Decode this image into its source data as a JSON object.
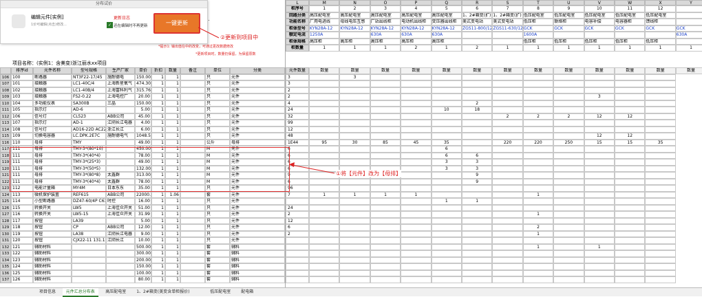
{
  "popup": {
    "title": "分布试价",
    "product_name": "编辑元件[实例]",
    "product_desc": "1价可编辑(点击)修改...",
    "link_label": "更新日志",
    "checkbox_label": "还在编辑时不再更新",
    "update_button": "一键更新"
  },
  "annotations": {
    "step2": "②更新到项目中",
    "step1": "①将【元件】改为【母排】",
    "note1": "*提示1: 输出值在中的改变，可通过更改数据修改",
    "note2": "*更新项目时，数量仍保留，为保留原数"
  },
  "left_header_suffix": "CD.",
  "project_name": "项目名称：(实例1：含美变)浙江丽水xx项目",
  "left_columns": [
    "排序id",
    "元件名称",
    "型号规格",
    "生产厂家",
    "单价",
    "折扣",
    "数量",
    "备注",
    "单位",
    "分类"
  ],
  "left_rows": [
    {
      "no": "106",
      "id": "100",
      "name": "断路器",
      "model": "NT3F22-17/45",
      "maker": "施耐德电",
      "price": "150.00",
      "d": "1",
      "q": "1",
      "unit": "只",
      "cat": "元件"
    },
    {
      "no": "107",
      "id": "101",
      "name": "接触器",
      "model": "LC1-40C/4",
      "maker": "上海新星氧气",
      "price": "474.30",
      "d": "1",
      "q": "1",
      "unit": "只",
      "cat": "元件"
    },
    {
      "no": "108",
      "id": "102",
      "name": "接触器",
      "model": "LC1-40B/4",
      "maker": "上海富科利气",
      "price": "315.76",
      "d": "1",
      "q": "1",
      "unit": "只",
      "cat": "元件"
    },
    {
      "no": "109",
      "id": "103",
      "name": "接触器",
      "model": "FS2-0.22",
      "maker": "上海电控厂",
      "price": "20.00",
      "d": "1",
      "q": "1",
      "unit": "只",
      "cat": "元件"
    },
    {
      "no": "110",
      "id": "104",
      "name": "多功能仪表",
      "model": "SA300B",
      "maker": "三晶",
      "price": "150.00",
      "d": "1",
      "q": "1",
      "unit": "只",
      "cat": "元件"
    },
    {
      "no": "111",
      "id": "105",
      "name": "指示灯",
      "model": "AD-6",
      "maker": "",
      "price": "5.00",
      "d": "1",
      "q": "1",
      "unit": "只",
      "cat": "元件"
    },
    {
      "no": "112",
      "id": "106",
      "name": "信号灯",
      "model": "CL523",
      "maker": "ABB公司",
      "price": "45.00",
      "d": "1",
      "q": "1",
      "unit": "只",
      "cat": "元件"
    },
    {
      "no": "113",
      "id": "107",
      "name": "指示灯",
      "model": "AD-1",
      "maker": "江阴长江电器",
      "price": "4.00",
      "d": "1",
      "q": "1",
      "unit": "只",
      "cat": "元件"
    },
    {
      "no": "114",
      "id": "108",
      "name": "信号灯",
      "model": "AD16-22D AC220V",
      "maker": "浙江长江",
      "price": "6.00",
      "d": "1",
      "q": "1",
      "unit": "只",
      "cat": "元件"
    },
    {
      "no": "115",
      "id": "109",
      "name": "切换电容器",
      "model": "LC.DPK.2E7C",
      "maker": "施耐德电气",
      "price": "1048.52",
      "d": "1",
      "q": "1",
      "unit": "只",
      "cat": "元件"
    },
    {
      "no": "116",
      "id": "110",
      "name": "母排",
      "model": "TMY",
      "maker": "",
      "price": "49.00",
      "d": "1",
      "q": "1",
      "unit": "公斤",
      "cat": "母排"
    },
    {
      "no": "117",
      "id": "111",
      "name": "母排",
      "model": "TMY-3*(80*10)",
      "maker": "",
      "price": "450.00",
      "d": "1",
      "q": "1",
      "unit": "M",
      "cat": "元件"
    },
    {
      "no": "118",
      "id": "111",
      "name": "母排",
      "model": "TMY-3*(40*4)",
      "maker": "",
      "price": "78.00",
      "d": "1",
      "q": "1",
      "unit": "M",
      "cat": "元件"
    },
    {
      "no": "119",
      "id": "111",
      "name": "母排",
      "model": "TMY-3*(25*3)",
      "maker": "",
      "price": "49.00",
      "d": "1",
      "q": "1",
      "unit": "M",
      "cat": "元件"
    },
    {
      "no": "120",
      "id": "111",
      "name": "母排",
      "model": "TMY-3*(50*5)",
      "maker": "",
      "price": "132.00",
      "d": "1",
      "q": "1",
      "unit": "M",
      "cat": "元件"
    },
    {
      "no": "121",
      "id": "111",
      "name": "母排",
      "model": "TMY-3*(80*8)",
      "maker": "太鑫群",
      "price": "313.00",
      "d": "1",
      "q": "1",
      "unit": "M",
      "cat": "元件"
    },
    {
      "no": "122",
      "id": "111",
      "name": "母排",
      "model": "TMY-3*(40*4)",
      "maker": "太鑫群",
      "price": "78.00",
      "d": "1",
      "q": "1",
      "unit": "M",
      "cat": "元件"
    },
    {
      "no": "123",
      "id": "112",
      "name": "电能计量箱",
      "model": "MY4M",
      "maker": "日本东东",
      "price": "35.00",
      "d": "1",
      "q": "1",
      "unit": "只",
      "cat": "元件"
    },
    {
      "no": "124",
      "id": "113",
      "name": "微机保护装置",
      "model": "REF615",
      "maker": "ABB公司",
      "price": "22000.00",
      "d": "1",
      "q": "1.06",
      "unit": "套",
      "cat": "元件"
    },
    {
      "no": "125",
      "id": "114",
      "name": "小型断路器",
      "model": "DZ47-60/4P C63A",
      "maker": "时控",
      "price": "16.00",
      "d": "1",
      "q": "1",
      "unit": "只",
      "cat": "元件"
    },
    {
      "no": "126",
      "id": "115",
      "name": "转换开关",
      "model": "LW5",
      "maker": "上海佳众开关",
      "price": "51.00",
      "d": "1",
      "q": "1",
      "unit": "只",
      "cat": "元件"
    },
    {
      "no": "127",
      "id": "116",
      "name": "转换开关",
      "model": "LW5-15",
      "maker": "上海佳众开关",
      "price": "31.99",
      "d": "1",
      "q": "1",
      "unit": "只",
      "cat": "元件"
    },
    {
      "no": "128",
      "id": "117",
      "name": "按钮",
      "model": "LA39",
      "maker": "",
      "price": "5.00",
      "d": "1",
      "q": "1",
      "unit": "只",
      "cat": "元件"
    },
    {
      "no": "129",
      "id": "118",
      "name": "按钮",
      "model": "CP",
      "maker": "ABB公司",
      "price": "12.00",
      "d": "1",
      "q": "1",
      "unit": "只",
      "cat": "元件"
    },
    {
      "no": "130",
      "id": "119",
      "name": "按钮",
      "model": "LA38",
      "maker": "江阴长江电器",
      "price": "9.00",
      "d": "1",
      "q": "1",
      "unit": "只",
      "cat": "元件"
    },
    {
      "no": "131",
      "id": "120",
      "name": "按钮",
      "model": "CJX22-11 131.1",
      "maker": "江阴长江",
      "price": "10.00",
      "d": "1",
      "q": "1",
      "unit": "只",
      "cat": "元件"
    },
    {
      "no": "132",
      "id": "121",
      "name": "辅助材料",
      "model": "",
      "maker": "",
      "price": "500.00",
      "d": "1",
      "q": "1",
      "unit": "套",
      "cat": "辅料"
    },
    {
      "no": "133",
      "id": "122",
      "name": "辅助材料",
      "model": "",
      "maker": "",
      "price": "300.00",
      "d": "1",
      "q": "1",
      "unit": "套",
      "cat": "辅料"
    },
    {
      "no": "134",
      "id": "123",
      "name": "辅助材料",
      "model": "",
      "maker": "",
      "price": "200.00",
      "d": "1",
      "q": "1",
      "unit": "套",
      "cat": "辅料"
    },
    {
      "no": "135",
      "id": "124",
      "name": "辅助材料",
      "model": "",
      "maker": "",
      "price": "150.00",
      "d": "1",
      "q": "1",
      "unit": "套",
      "cat": "辅料"
    },
    {
      "no": "136",
      "id": "125",
      "name": "辅助材料",
      "model": "",
      "maker": "",
      "price": "100.00",
      "d": "1",
      "q": "1",
      "unit": "套",
      "cat": "辅料"
    },
    {
      "no": "137",
      "id": "126",
      "name": "辅助材料",
      "model": "",
      "maker": "",
      "price": "80.00",
      "d": "1",
      "q": "1",
      "unit": "套",
      "cat": "辅料"
    }
  ],
  "right_col_letters": [
    "L",
    "M",
    "N",
    "O",
    "P",
    "Q",
    "R",
    "S",
    "T",
    "U",
    "V",
    "W",
    "X",
    "Y"
  ],
  "right_header_rows": [
    {
      "no": "1",
      "label": "柜序号",
      "cells": [
        "1",
        "2",
        "3",
        "4",
        "5",
        "6",
        "7",
        "8",
        "9",
        "10",
        "11",
        "12",
        ""
      ]
    },
    {
      "no": "2",
      "label": "回路分类",
      "cells": [
        "高压配电室",
        "高压配电室",
        "高压配电室",
        "高压配电室",
        "高压配电室",
        "1、2#箱变(扩)",
        "1、2#箱变(扩)",
        "低压配电室",
        "低压配电室",
        "低压配电室",
        "低压配电室",
        "低压配电室",
        ""
      ]
    },
    {
      "no": "3",
      "label": "功能名称",
      "cells": [
        "厂用电进线",
        "母线电压互感",
        "厂站出线柜",
        "电动机出线柜",
        "变压器出线柜",
        "美式变电站",
        "美式变电站",
        "低压柜",
        "联络柜",
        "电容补偿",
        "电容器柜",
        "馈线柜",
        ""
      ]
    },
    {
      "no": "4",
      "label": "柜体型号",
      "cells": [
        "KYN28A-12",
        "KYN28A-12",
        "KYN28A-12",
        "KYN28A-12",
        "KYN28A-12",
        "ZGS11-800/12",
        "ZGS11-630/12",
        "GCK",
        "GCK",
        "GCK",
        "GCK",
        "GCK",
        "GCK"
      ]
    },
    {
      "no": "5",
      "label": "额定电流",
      "cells": [
        "1250A",
        "",
        "630A",
        "630A",
        "630A",
        "",
        "",
        "1600A",
        "",
        "",
        "",
        "",
        "630A"
      ]
    },
    {
      "no": "6",
      "label": "柜体规格",
      "cells": [
        "高压柜",
        "高压柜",
        "高压柜",
        "高压柜",
        "高压柜",
        "",
        "",
        "低压柜",
        "低压柜",
        "低压柜",
        "低压柜",
        "低压柜",
        ""
      ]
    },
    {
      "no": "7",
      "label": "柜数量",
      "cells": [
        "1",
        "1",
        "1",
        "2",
        "1",
        "2",
        "1",
        "1",
        "1",
        "1",
        "1",
        "1",
        "1"
      ]
    }
  ],
  "qty_header": {
    "label": "元件数量",
    "cells": [
      "数量",
      "数量",
      "数量",
      "数量",
      "数量",
      "数量",
      "数量",
      "数量",
      "数量",
      "数量",
      "数量",
      "数量",
      "数量"
    ]
  },
  "right_rows": [
    [
      "3",
      "",
      "3",
      "",
      "",
      "",
      "",
      "",
      "",
      "",
      "",
      "",
      ""
    ],
    [
      "3",
      "",
      "",
      "",
      "",
      "",
      "",
      "",
      "",
      "",
      "",
      "",
      ""
    ],
    [
      "2",
      "",
      "",
      "",
      "",
      "",
      "",
      "",
      "",
      "",
      "",
      "",
      ""
    ],
    [
      "2",
      "",
      "",
      "",
      "",
      "",
      "",
      "",
      "",
      "",
      "3",
      "",
      ""
    ],
    [
      "4",
      "",
      "",
      "",
      "",
      "",
      "2",
      "",
      "",
      "",
      "",
      "",
      ""
    ],
    [
      "24",
      "",
      "",
      "",
      "",
      "10",
      "18",
      "",
      "",
      "",
      "",
      "",
      ""
    ],
    [
      "32",
      "",
      "",
      "",
      "",
      "",
      "",
      "2",
      "2",
      "2",
      "12",
      "12",
      ""
    ],
    [
      "99",
      "",
      "",
      "",
      "",
      "",
      "",
      "",
      "",
      "",
      "",
      "",
      ""
    ],
    [
      "12",
      "",
      "",
      "",
      "",
      "",
      "",
      "",
      "",
      "",
      "",
      "",
      ""
    ],
    [
      "48",
      "",
      "",
      "",
      "",
      "",
      "",
      "",
      "",
      "",
      "12",
      "12",
      ""
    ],
    [
      "1E44",
      "95",
      "30",
      "85",
      "45",
      "35",
      "",
      "220",
      "220",
      "250",
      "15",
      "15",
      "35"
    ],
    [
      "6",
      "",
      "",
      "",
      "",
      "6",
      "",
      "",
      "",
      "",
      "",
      "",
      ""
    ],
    [
      "6",
      "",
      "",
      "",
      "",
      "6",
      "6",
      "",
      "",
      "",
      "",
      "",
      ""
    ],
    [
      "6",
      "",
      "",
      "",
      "",
      "3",
      "3",
      "",
      "",
      "",
      "",
      "",
      ""
    ],
    [
      "6",
      "",
      "",
      "",
      "",
      "3",
      "3",
      "",
      "",
      "",
      "",
      "",
      ""
    ],
    [
      "9",
      "",
      "",
      "",
      "",
      "",
      "9",
      "",
      "",
      "",
      "",
      "",
      ""
    ],
    [
      "6",
      "",
      "",
      "",
      "",
      "",
      "9",
      "",
      "",
      "",
      "",
      "",
      ""
    ],
    [
      "96",
      "",
      "",
      "",
      "",
      "",
      "",
      "",
      "",
      "",
      "",
      "",
      ""
    ],
    [
      "7",
      "1",
      "1",
      "1",
      "1",
      "",
      "",
      "",
      "1",
      "",
      "",
      "",
      ""
    ],
    [
      "",
      "",
      "",
      "",
      "",
      "1",
      "1",
      "",
      "",
      "",
      "",
      "",
      ""
    ],
    [
      "24",
      "",
      "",
      "",
      "",
      "",
      "",
      "",
      "",
      "",
      "",
      "",
      ""
    ],
    [
      "2",
      "",
      "",
      "",
      "",
      "",
      "",
      "",
      "1",
      "",
      "",
      "",
      ""
    ],
    [
      "12",
      "",
      "",
      "",
      "",
      "",
      "",
      "",
      "",
      "",
      "",
      "",
      ""
    ],
    [
      "6",
      "",
      "",
      "",
      "",
      "",
      "",
      "",
      "2",
      "",
      "",
      "",
      ""
    ],
    [
      "2",
      "",
      "",
      "",
      "",
      "",
      "",
      "",
      "1",
      "",
      "",
      "",
      ""
    ],
    [
      "",
      "",
      "",
      "",
      "",
      "",
      "",
      "",
      "",
      "",
      "",
      "",
      ""
    ],
    [
      "",
      "",
      "",
      "",
      "",
      "",
      "",
      "",
      "1",
      "",
      "1",
      "",
      ""
    ],
    [
      "",
      "",
      "",
      "",
      "",
      "",
      "",
      "",
      "",
      "",
      "",
      "",
      ""
    ],
    [
      "",
      "",
      "",
      "",
      "",
      "",
      "",
      "",
      "",
      "",
      "",
      "",
      ""
    ],
    [
      "",
      "",
      "",
      "",
      "",
      "",
      "",
      "",
      "",
      "",
      "",
      "",
      ""
    ],
    [
      "",
      "",
      "",
      "",
      "",
      "",
      "",
      "",
      "",
      "",
      "",
      "",
      ""
    ],
    [
      "",
      "",
      "",
      "",
      "",
      "",
      "",
      "",
      "",
      "",
      "",
      "",
      ""
    ]
  ],
  "tabs": [
    "项目信息",
    "元件汇总分布表",
    "高压配电室",
    "1、2#箱变(美变含单柜报价)",
    "低压配电室",
    "配电箱"
  ],
  "active_tab": 1,
  "colors": {
    "accent": "#e87728",
    "annotation": "#d22222",
    "highlight_box": "#e03030",
    "link": "#1a3fc8"
  }
}
